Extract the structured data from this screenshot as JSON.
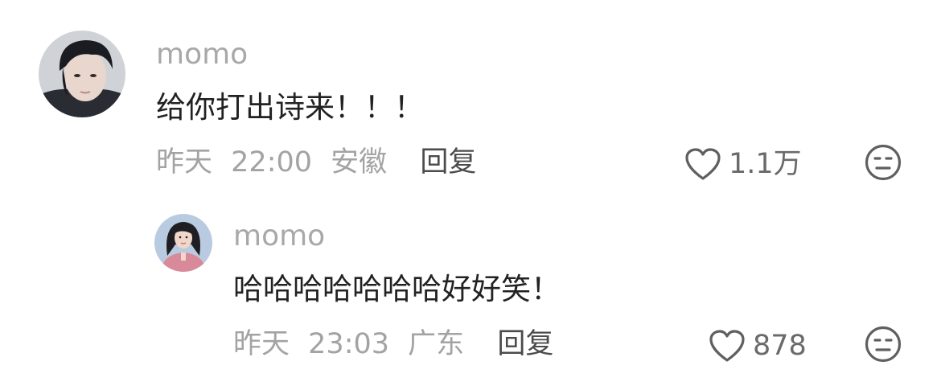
{
  "comments": [
    {
      "username": "momo",
      "text": "给你打出诗来！！！",
      "date": "昨天",
      "time": "22:00",
      "location": "安徽",
      "reply_label": "回复",
      "likes": "1.1万"
    },
    {
      "username": "momo",
      "text": "哈哈哈哈哈哈哈好好笑！",
      "date": "昨天",
      "time": "23:03",
      "location": "广东",
      "reply_label": "回复",
      "likes": "878"
    }
  ],
  "colors": {
    "username": "#a8a8a8",
    "content": "#222222",
    "meta": "#a3a3a3",
    "reply": "#4b4b4b",
    "icon": "#6a6a6a"
  },
  "icons": {
    "like": "heart-outline-icon",
    "dislike": "neutral-face-icon"
  }
}
